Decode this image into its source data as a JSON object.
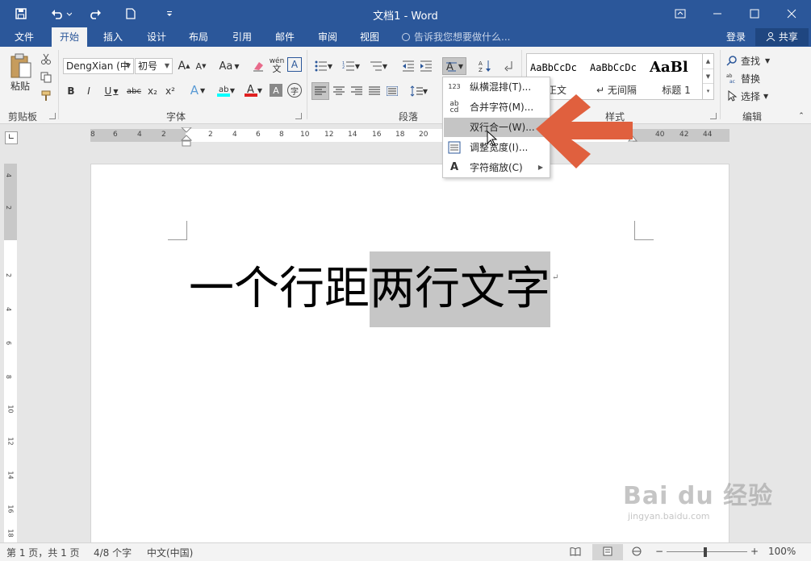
{
  "window": {
    "title": "文档1 - Word",
    "controls": {
      "restore": "⧉",
      "minimize": "—",
      "maximize": "☐",
      "close": "✕"
    }
  },
  "quick_access": {
    "save_icon": "save-icon",
    "undo_icon": "undo-icon",
    "redo_icon": "redo-icon",
    "new_icon": "new-doc-icon"
  },
  "tabs": [
    {
      "label": "文件"
    },
    {
      "label": "开始"
    },
    {
      "label": "插入"
    },
    {
      "label": "设计"
    },
    {
      "label": "布局"
    },
    {
      "label": "引用"
    },
    {
      "label": "邮件"
    },
    {
      "label": "审阅"
    },
    {
      "label": "视图"
    }
  ],
  "tell_me": {
    "placeholder": "告诉我您想要做什么..."
  },
  "account": {
    "login": "登录",
    "share": "共享"
  },
  "ribbon": {
    "clipboard": {
      "paste_label": "粘贴",
      "group_label": "剪贴板"
    },
    "font": {
      "font_name": "DengXian (中",
      "font_size": "初号",
      "group_label": "字体",
      "bold": "B",
      "italic": "I",
      "underline": "U",
      "strike": "abc",
      "sub": "x₂",
      "sup": "x²",
      "aa": "Aa",
      "grow": "A",
      "shrink": "A",
      "char_border": "A",
      "wen": "wén",
      "phonetic": "A",
      "effects": "A",
      "font_color": "A",
      "char_shade": "A",
      "enclose": "字"
    },
    "paragraph": {
      "group_label": "段落"
    },
    "styles": {
      "group_label": "样式",
      "items": [
        {
          "sample": "AaBbCcDc",
          "name": "正文"
        },
        {
          "sample": "AaBbCcDc",
          "name": "无间隔"
        },
        {
          "sample": "AaBl",
          "name": "标题 1"
        }
      ]
    },
    "editing": {
      "find": "查找",
      "replace": "替换",
      "select": "选择",
      "group_label": "编辑"
    }
  },
  "asian_layout_menu": {
    "items": [
      {
        "label": "纵横混排(T)...",
        "icon": "vertical-horizontal-icon",
        "icon_text": "123"
      },
      {
        "label": "合并字符(M)...",
        "icon": "combine-chars-icon",
        "icon_text": "ab\ncd"
      },
      {
        "label": "双行合一(W)...",
        "icon": "two-lines-in-one-icon",
        "icon_text": ""
      },
      {
        "label": "调整宽度(I)...",
        "icon": "fit-text-icon",
        "icon_text": ""
      },
      {
        "label": "字符缩放(C)",
        "icon": "char-scale-icon",
        "icon_text": "A"
      }
    ]
  },
  "ruler": {
    "h_labels": [
      "8",
      "6",
      "4",
      "2",
      "2",
      "4",
      "6",
      "8",
      "10",
      "12",
      "14",
      "16",
      "18",
      "20",
      "40",
      "42",
      "44"
    ],
    "v_labels": [
      "4",
      "2",
      "2",
      "4",
      "6",
      "8",
      "10",
      "12",
      "14",
      "16",
      "18"
    ]
  },
  "document": {
    "text_plain": "一个行距",
    "text_selected": "两行文字",
    "para_mark": "↵"
  },
  "status": {
    "page": "第 1 页，共 1 页",
    "words": "4/8 个字",
    "language": "中文(中国)",
    "zoom": "100%",
    "zoom_minus": "−",
    "zoom_plus": "+"
  },
  "watermark": {
    "brand": "Bai du 经验",
    "url": "jingyan.baidu.com"
  },
  "colors": {
    "accent": "#2b579a",
    "arrow": "#e0603e",
    "selection": "#c6c6c6"
  }
}
